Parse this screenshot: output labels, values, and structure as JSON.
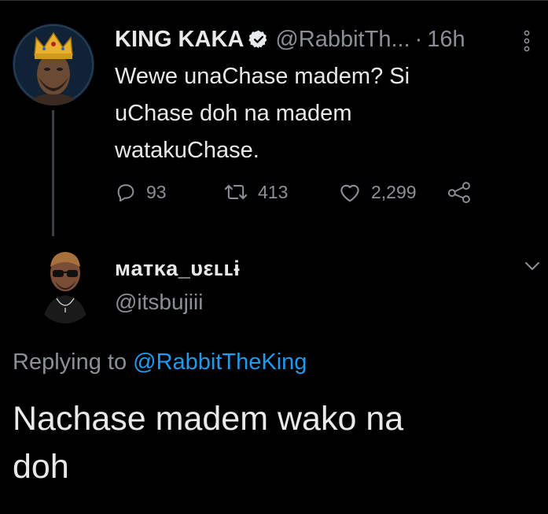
{
  "parent_tweet": {
    "display_name": "KING KAKA",
    "handle_truncated": "@RabbitTh...",
    "separator": "·",
    "time": "16h",
    "text_lines": [
      "Wewe unaChase madem? Si",
      "uChase doh na madem",
      "watakuChase."
    ],
    "replies": "93",
    "retweets": "413",
    "likes": "2,299",
    "avatar_icon": "king-crown-avatar",
    "verified_icon": "verified-badge-icon"
  },
  "reply_tweet": {
    "display_name": "мaтĸa_υεʟʟɨ",
    "handle": "@itsbujiii",
    "replying_prefix": "Replying to",
    "replying_mention": "@RabbitTheKing",
    "text_lines": [
      "Nachase madem wako na",
      "doh"
    ],
    "avatar_icon": "sunglasses-man-avatar"
  },
  "colors": {
    "background": "#000000",
    "primary_text": "#e7e9ea",
    "secondary_text": "#8b9096",
    "link": "#1d9bf0",
    "divider": "#2f3336"
  }
}
